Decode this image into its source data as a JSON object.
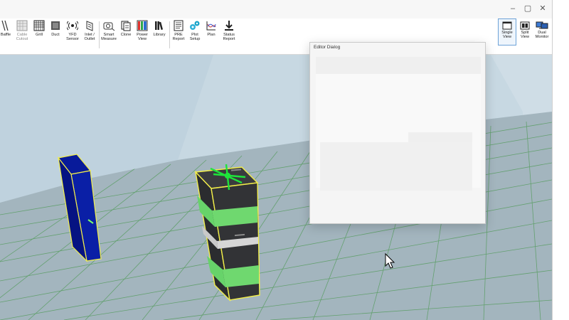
{
  "toolbar": {
    "tools": [
      {
        "id": "baffle",
        "label": "Baffle",
        "icon": "baffle-icon"
      },
      {
        "id": "cable-cutout",
        "label": "Cable\nCutout",
        "icon": "cable-cutout-icon"
      },
      {
        "id": "grill",
        "label": "Grill",
        "icon": "grill-icon"
      },
      {
        "id": "duct",
        "label": "Duct",
        "icon": "duct-icon"
      },
      {
        "id": "yfd-sensor",
        "label": "YFD\nSensor",
        "icon": "sensor-icon"
      },
      {
        "id": "inlet-outlet",
        "label": "Inlet /\nOutlet",
        "icon": "inlet-outlet-icon"
      },
      {
        "id": "smart-measure",
        "label": "Smart\nMeasure",
        "icon": "smart-measure-icon"
      },
      {
        "id": "clone",
        "label": "Clone",
        "icon": "clone-icon"
      },
      {
        "id": "power-view",
        "label": "Power\nView",
        "icon": "power-view-icon"
      },
      {
        "id": "library",
        "label": "Library",
        "icon": "library-icon"
      },
      {
        "id": "pre-report",
        "label": "PRE\nReport",
        "icon": "pre-report-icon"
      },
      {
        "id": "plot-setup",
        "label": "Plot\nSetup",
        "icon": "plot-setup-icon"
      },
      {
        "id": "plan",
        "label": "Plan",
        "icon": "plan-icon"
      },
      {
        "id": "status-report",
        "label": "Status\nReport",
        "icon": "status-report-icon"
      }
    ],
    "view_modes": [
      {
        "id": "single-view",
        "label": "Single\nView",
        "icon": "single-view-icon",
        "active": true
      },
      {
        "id": "split-view",
        "label": "Split\nView",
        "icon": "split-view-icon",
        "active": false
      },
      {
        "id": "dual-monitor",
        "label": "Dual\nMonitor",
        "icon": "dual-monitor-icon",
        "active": false
      }
    ]
  },
  "window_controls": {
    "minimize": "–",
    "maximize": "▢",
    "close": "✕"
  },
  "dialog": {
    "title": "Editor Dialog"
  },
  "colors": {
    "floor": "#9fb2bb",
    "grid": "#4f9a56",
    "wall_left": "#bccfdb",
    "wall_back": "#d2e0e8",
    "panel_blue": "#0a1fa6",
    "cabinet": "#2f3033",
    "stripe_green": "#67d36a",
    "selection": "#f2ee4a",
    "gizmo": "#1ee33b"
  }
}
